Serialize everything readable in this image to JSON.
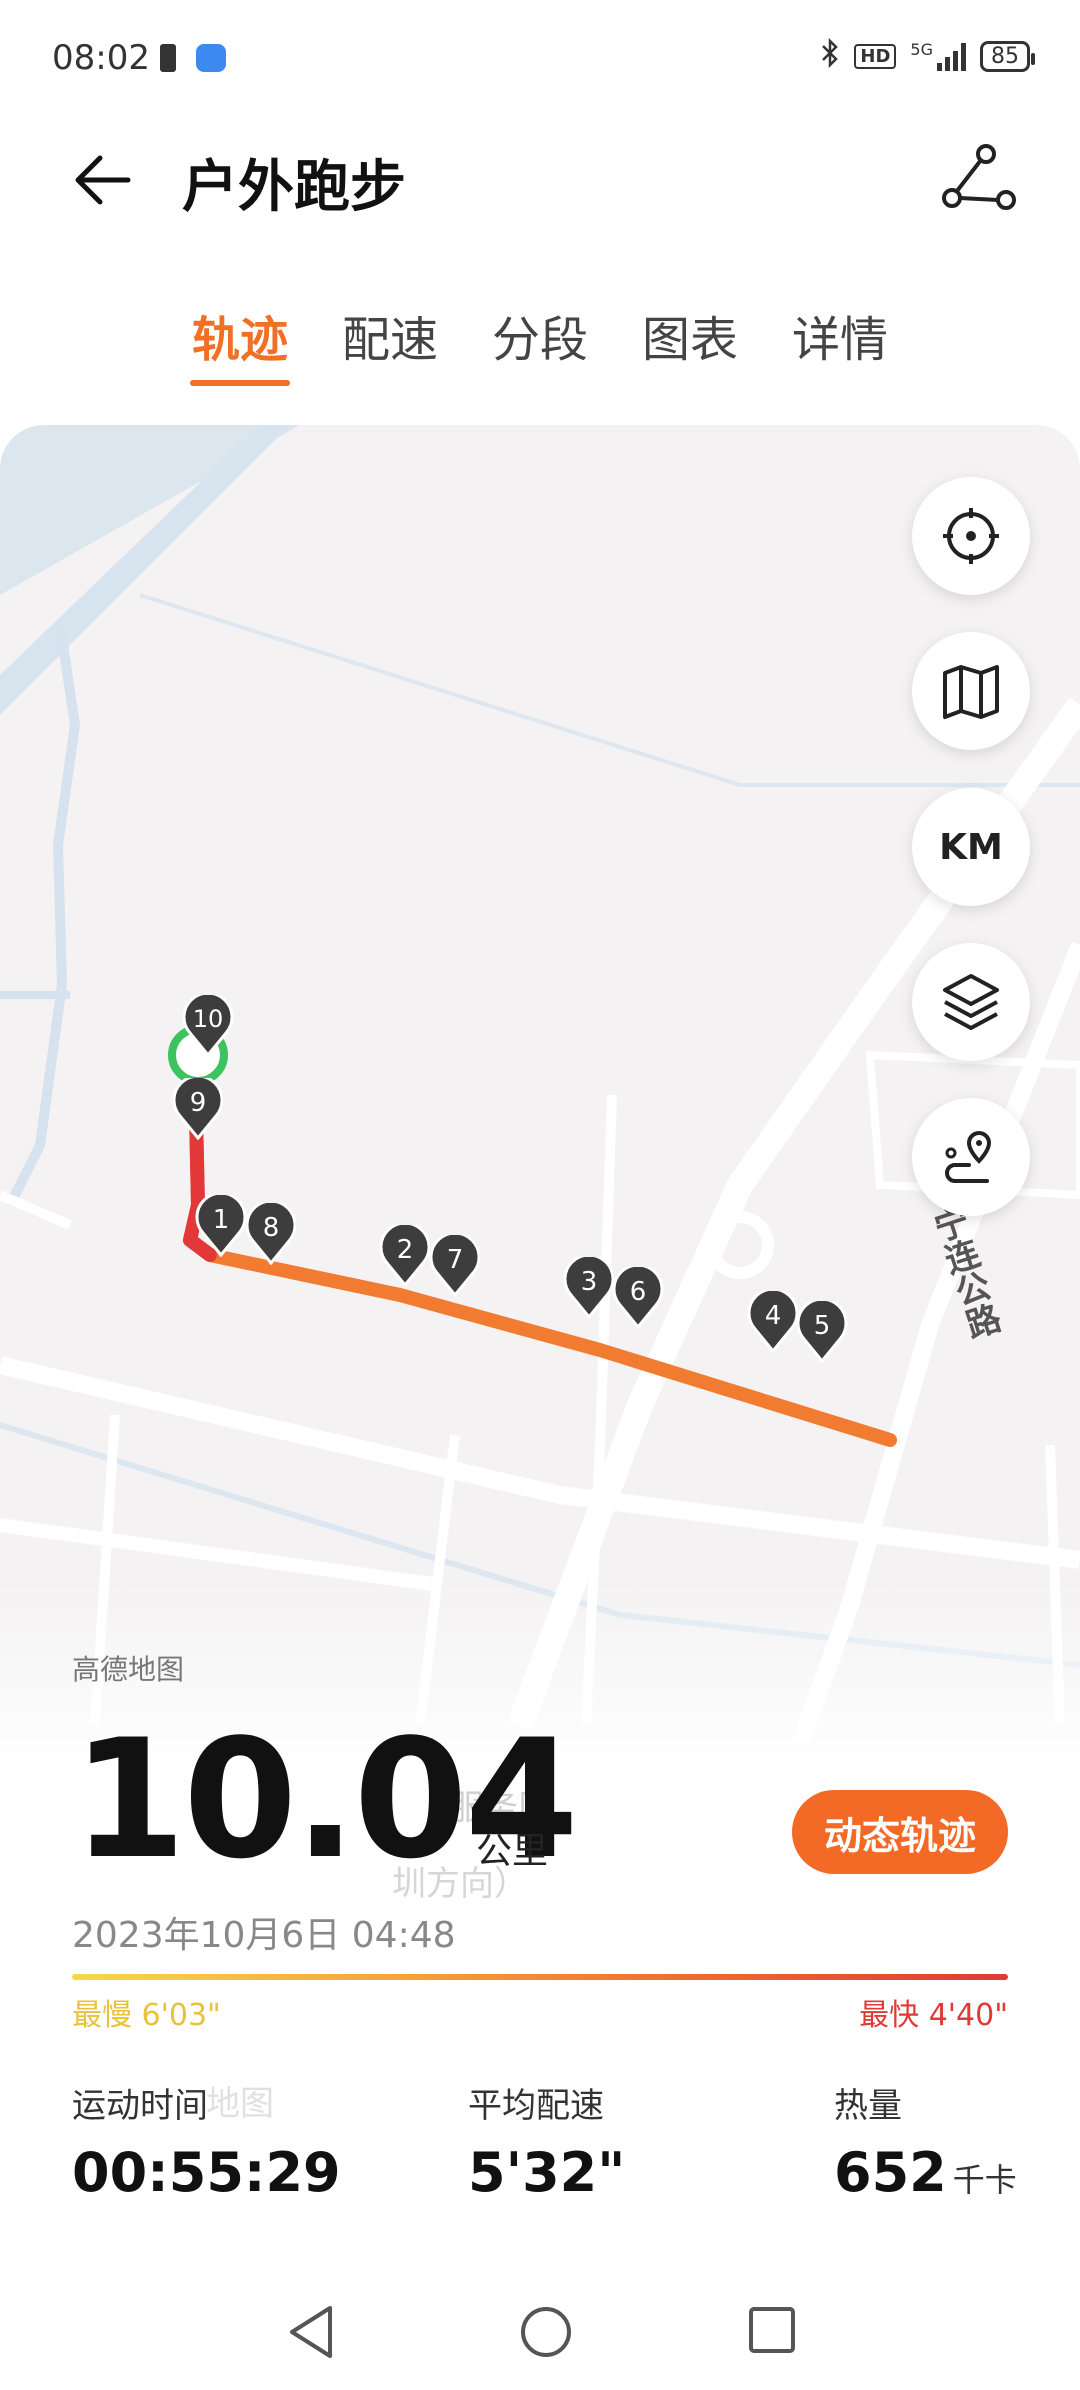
{
  "status": {
    "time": "08:02",
    "hd": "HD",
    "network": "5G",
    "battery": "85"
  },
  "header": {
    "title": "户外跑步"
  },
  "tabs": [
    "轨迹",
    "配速",
    "分段",
    "图表",
    "详情"
  ],
  "map": {
    "provider": "高德地图",
    "road_label": "宁连公路",
    "km_label": "KM",
    "markers": [
      "1",
      "2",
      "3",
      "4",
      "5",
      "6",
      "7",
      "8",
      "9",
      "10"
    ],
    "faded_labels": [
      "服务区",
      "圳方向）",
      "地图"
    ]
  },
  "summary": {
    "distance": "10.04",
    "distance_unit": "公里",
    "dynamic_track": "动态轨迹",
    "date": "2023年10月6日 04:48",
    "slowest": "最慢 6'03\"",
    "fastest": "最快 4'40\""
  },
  "stats": [
    {
      "label": "运动时间",
      "value": "00:55:29",
      "unit": ""
    },
    {
      "label": "平均配速",
      "value": "5'32\"",
      "unit": ""
    },
    {
      "label": "热量",
      "value": "652",
      "unit": "千卡"
    }
  ],
  "colors": {
    "accent": "#f26a25",
    "track_start": "#e03a36",
    "track_end": "#f07e30",
    "start_marker": "#3cc25e"
  }
}
